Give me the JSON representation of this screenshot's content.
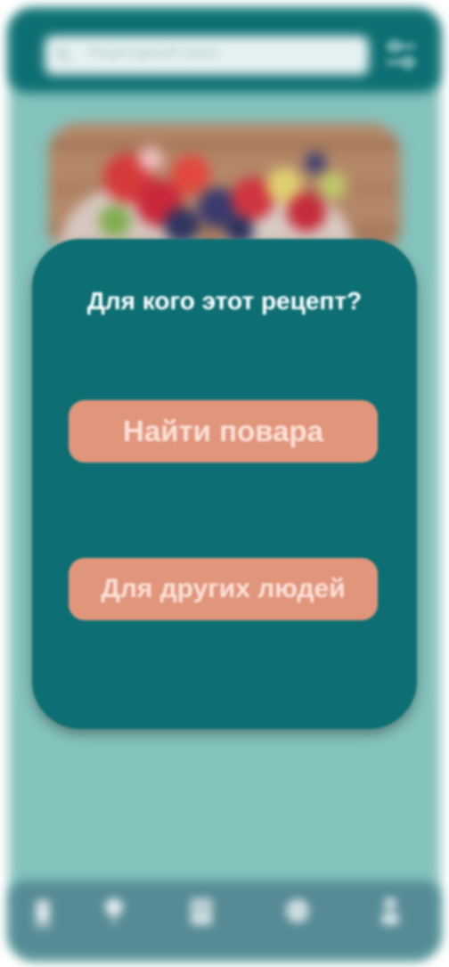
{
  "search": {
    "placeholder": "Рецептурный поиск"
  },
  "icons": {
    "search": "search-icon",
    "filter": "filter-sliders-icon",
    "nav": [
      "home-icon",
      "pin-icon",
      "book-icon",
      "globe-icon",
      "person-icon"
    ]
  },
  "colors": {
    "app_background": "#85c3bd",
    "primary": "#0d6f73",
    "button": "#e1957b",
    "button_text": "#fce2da",
    "nav_bar": "#568b95"
  },
  "modal": {
    "title": "Для кого этот рецепт?",
    "find_cook_label": "Найти повара",
    "for_others_label": "Для других людей"
  }
}
